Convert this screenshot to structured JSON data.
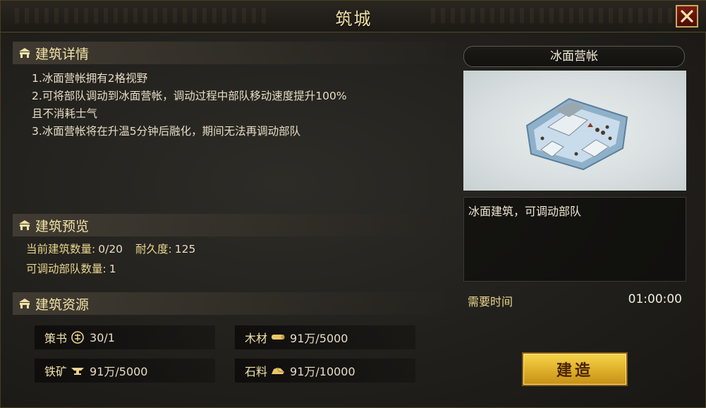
{
  "window": {
    "title": "筑城"
  },
  "icons": {
    "close": "close-x-icon",
    "section": "camp-gate-icon",
    "strategy_book": "strategy-book-icon",
    "wood": "wood-log-icon",
    "iron": "iron-anvil-icon",
    "stone": "stone-icon"
  },
  "colors": {
    "gold_text": "#f3e1a6",
    "button_gold": "#e0b22b",
    "close_red": "#7a1c12"
  },
  "sections": {
    "details": {
      "header": "建筑详情",
      "lines": [
        "1.冰面营帐拥有2格视野",
        "2.可将部队调动到冰面营帐，调动过程中部队移动速度提升100%",
        "且不消耗士气",
        "3.冰面营帐将在升温5分钟后融化，期间无法再调动部队"
      ]
    },
    "preview": {
      "header": "建筑预览",
      "count_label": "当前建筑数量:",
      "count_value": "0/20",
      "durability_label": "耐久度:",
      "durability_value": "125",
      "troops_label": "可调动部队数量:",
      "troops_value": "1"
    },
    "resources": {
      "header": "建筑资源",
      "items": [
        {
          "name": "策书",
          "value": "30/1"
        },
        {
          "name": "木材",
          "value": "91万/5000"
        },
        {
          "name": "铁矿",
          "value": "91万/5000"
        },
        {
          "name": "石料",
          "value": "91万/10000"
        }
      ]
    }
  },
  "building": {
    "name": "冰面营帐",
    "description": "冰面建筑，可调动部队",
    "time_label": "需要时间",
    "time_value": "01:00:00",
    "build_button": "建造"
  }
}
